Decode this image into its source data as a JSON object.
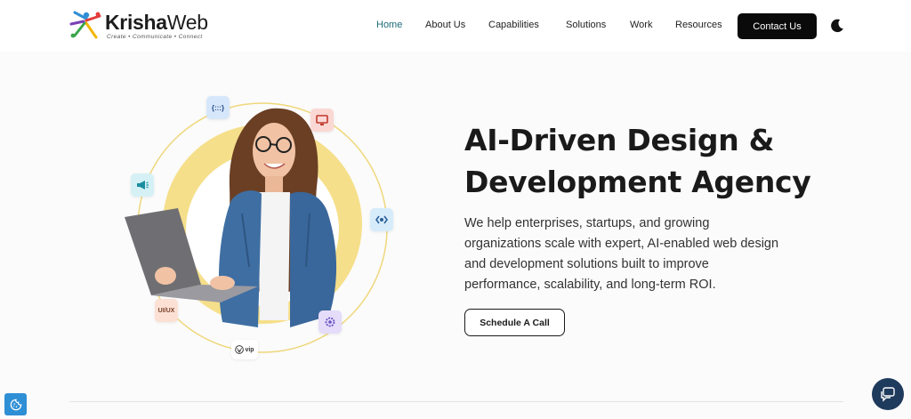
{
  "brand": {
    "name_bold": "Krisha",
    "name_light": "Web",
    "tagline": "Create • Communicate • Connect"
  },
  "nav": {
    "items": [
      {
        "label": "Home",
        "active": true
      },
      {
        "label": "About Us",
        "active": false
      },
      {
        "label": "Capabilities",
        "active": false
      },
      {
        "label": "Solutions",
        "active": false
      },
      {
        "label": "Work",
        "active": false
      },
      {
        "label": "Resources",
        "active": false
      }
    ],
    "contact_label": "Contact Us"
  },
  "hero": {
    "title": "AI-Driven Design & Development Agency",
    "subtitle": "We help enterprises, startups, and growing organizations scale with expert, AI-enabled web design and development solutions built to improve performance, scalability, and long-term ROI.",
    "cta_label": "Schedule A Call",
    "badges": {
      "code": "{:::}",
      "uiux": "UI/UX",
      "wpvip": "vip"
    }
  },
  "icons": {
    "theme_toggle": "moon-icon",
    "cookie": "cookie-icon",
    "chat": "chat-icon"
  },
  "colors": {
    "accent_nav": "#1e6a7a",
    "contact_bg": "#0a0a0a",
    "circle_yellow": "#f6df8a",
    "chat_bg": "#1e3a5c",
    "cookie_bg": "#2f8fd5"
  }
}
